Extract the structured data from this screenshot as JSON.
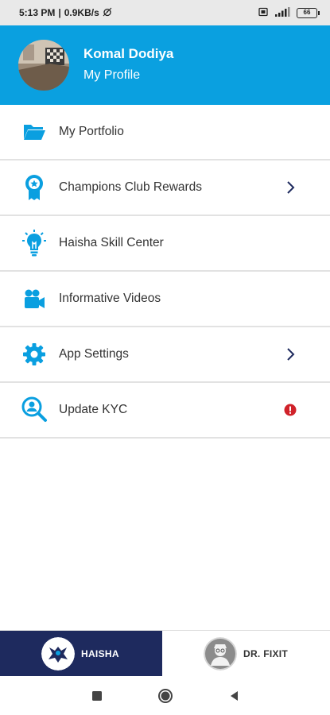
{
  "status_bar": {
    "time": "5:13 PM",
    "speed": "0.9KB/s",
    "battery": "66"
  },
  "profile": {
    "name": "Komal Dodiya",
    "link_label": "My Profile"
  },
  "menu": {
    "items": [
      {
        "label": "My Portfolio",
        "icon": "folder-icon",
        "trail": "none"
      },
      {
        "label": "Champions Club Rewards",
        "icon": "medal-icon",
        "trail": "chevron-right-icon"
      },
      {
        "label": "Haisha Skill Center",
        "icon": "lightbulb-icon",
        "trail": "none"
      },
      {
        "label": "Informative Videos",
        "icon": "video-camera-icon",
        "trail": "none"
      },
      {
        "label": "App Settings",
        "icon": "gear-icon",
        "trail": "chevron-right-icon"
      },
      {
        "label": "Update KYC",
        "icon": "user-search-icon",
        "trail": "alert-icon"
      }
    ]
  },
  "bottom_tabs": [
    {
      "label": "HAISHA",
      "active": true
    },
    {
      "label": "DR. FIXIT",
      "active": false
    }
  ],
  "colors": {
    "header_blue": "#0aa0e0",
    "icon_blue": "#0a9fe0",
    "tab_navy": "#1e2a5e",
    "chevron": "#1e2a5e",
    "alert_red": "#d0222a"
  }
}
